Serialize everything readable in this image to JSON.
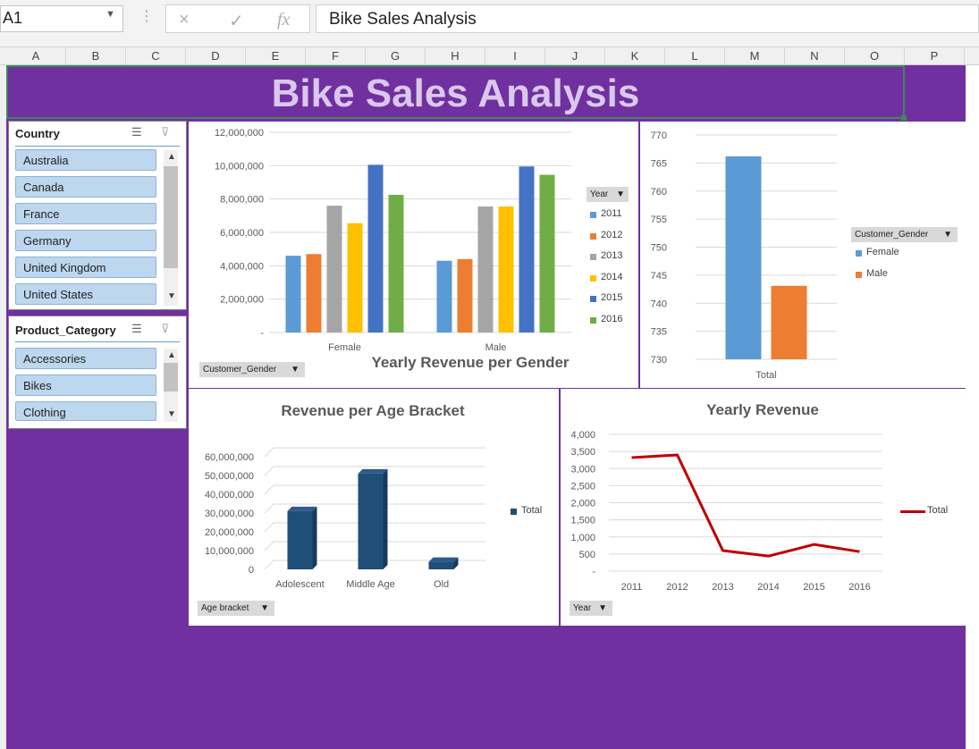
{
  "formula_bar": {
    "name_box": "A1",
    "cancel_icon": "×",
    "enter_icon": "✓",
    "fx_icon": "fx",
    "formula": "Bike Sales Analysis"
  },
  "columns": [
    "A",
    "B",
    "C",
    "D",
    "E",
    "F",
    "G",
    "H",
    "I",
    "J",
    "K",
    "L",
    "M",
    "N",
    "O",
    "P"
  ],
  "dashboard": {
    "title": "Bike Sales Analysis",
    "background_color": "#7030a0",
    "title_color": "#d9c8ec"
  },
  "slicers": {
    "country": {
      "title": "Country",
      "items": [
        "Australia",
        "Canada",
        "France",
        "Germany",
        "United Kingdom",
        "United States"
      ]
    },
    "product_category": {
      "title": "Product_Category",
      "items": [
        "Accessories",
        "Bikes",
        "Clothing"
      ]
    }
  },
  "chart_data": [
    {
      "id": "gender_year",
      "type": "bar",
      "title": "Yearly Revenue per Gender",
      "categories": [
        "Female",
        "Male"
      ],
      "series": [
        {
          "name": "2011",
          "color": "#5b9bd5",
          "values": [
            4600000,
            4300000
          ]
        },
        {
          "name": "2012",
          "color": "#ed7d31",
          "values": [
            4700000,
            4400000
          ]
        },
        {
          "name": "2013",
          "color": "#a5a5a5",
          "values": [
            7600000,
            7550000
          ]
        },
        {
          "name": "2014",
          "color": "#ffc000",
          "values": [
            6550000,
            7550000
          ]
        },
        {
          "name": "2015",
          "color": "#4472c4",
          "values": [
            10050000,
            9950000
          ]
        },
        {
          "name": "2016",
          "color": "#70ad47",
          "values": [
            8250000,
            9450000
          ]
        }
      ],
      "y_ticks": [
        "-",
        "2,000,000",
        "4,000,000",
        "6,000,000",
        "8,000,000",
        "10,000,000",
        "12,000,000"
      ],
      "ylim": [
        0,
        12000000
      ],
      "legend_title": "Year",
      "legend_position": "right",
      "filter_button": "Customer_Gender"
    },
    {
      "id": "gender_total",
      "type": "bar",
      "categories": [
        "Total"
      ],
      "series": [
        {
          "name": "Female",
          "color": "#5b9bd5",
          "values": [
            766.2
          ]
        },
        {
          "name": "Male",
          "color": "#ed7d31",
          "values": [
            743.1
          ]
        }
      ],
      "y_ticks": [
        "730",
        "735",
        "740",
        "745",
        "750",
        "755",
        "760",
        "765",
        "770"
      ],
      "ylim": [
        730,
        770
      ],
      "legend_title": "Customer_Gender",
      "legend_position": "right"
    },
    {
      "id": "age_bracket",
      "type": "bar",
      "title": "Revenue per Age Bracket",
      "categories": [
        "Adolescent",
        "Middle Age",
        "Old"
      ],
      "series": [
        {
          "name": "Total",
          "color": "#1f4e79",
          "values": [
            31000000,
            51000000,
            4000000
          ]
        }
      ],
      "y_ticks": [
        "0",
        "10,000,000",
        "20,000,000",
        "30,000,000",
        "40,000,000",
        "50,000,000",
        "60,000,000"
      ],
      "ylim": [
        0,
        60000000
      ],
      "legend_position": "right",
      "filter_button": "Age bracket"
    },
    {
      "id": "yearly_revenue",
      "type": "line",
      "title": "Yearly Revenue",
      "x": [
        "2011",
        "2012",
        "2013",
        "2014",
        "2015",
        "2016"
      ],
      "series": [
        {
          "name": "Total",
          "color": "#c00000",
          "values": [
            3320,
            3400,
            600,
            440,
            780,
            570
          ]
        }
      ],
      "y_ticks": [
        "-",
        "500",
        "1,000",
        "1,500",
        "2,000",
        "2,500",
        "3,000",
        "3,500",
        "4,000"
      ],
      "ylim": [
        0,
        4000
      ],
      "legend_position": "right",
      "filter_button": "Year"
    }
  ]
}
